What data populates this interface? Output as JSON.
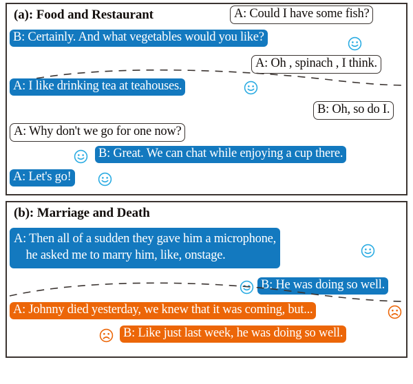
{
  "figure": {
    "colors": {
      "speaker_a_positive": "#1379bf",
      "speaker_b_positive": "#1379bf",
      "negative": "#ec6608",
      "neutral_border": "#3a3330",
      "panel_border": "#3a3330",
      "emoji_happy": "#29ABE2",
      "emoji_sad": "#ec6608",
      "text_on_color": "#ffffff",
      "text_plain": "#120d0b"
    },
    "panels": [
      {
        "id": "a",
        "title": "(a): Food and Restaurant",
        "messages": [
          {
            "id": "a1",
            "text": "A: Could I have some fish?",
            "style": "plain",
            "emoji": "none"
          },
          {
            "id": "a2",
            "text": "B: Certainly. And what vegetables would you like?",
            "style": "blue",
            "emoji": "happy"
          },
          {
            "id": "a3",
            "text": "A: Oh , spinach , I think.",
            "style": "plain",
            "emoji": "none"
          },
          {
            "id": "a4",
            "text": "A: I like drinking tea at teahouses.",
            "style": "blue",
            "emoji": "happy"
          },
          {
            "id": "a5",
            "text": "B: Oh, so do I.",
            "style": "plain",
            "emoji": "none"
          },
          {
            "id": "a6",
            "text": "A: Why don't we go for one now?",
            "style": "plain",
            "emoji": "none"
          },
          {
            "id": "a7",
            "text": "B: Great. We can chat while enjoying a cup there.",
            "style": "blue",
            "emoji": "happy"
          },
          {
            "id": "a8",
            "text": "A: Let's go!",
            "style": "blue",
            "emoji": "happy"
          }
        ],
        "separator_after": "a3"
      },
      {
        "id": "b",
        "title": "(b): Marriage and Death",
        "messages": [
          {
            "id": "b1",
            "line1": "A: Then all of a sudden they gave him a microphone,",
            "line2": "    he asked me to marry him, like, onstage.",
            "style": "blue",
            "emoji": "happy"
          },
          {
            "id": "b2",
            "text": "B: He was doing so well.",
            "style": "blue",
            "emoji": "happy"
          },
          {
            "id": "b3",
            "text": "A: Johnny died yesterday, we knew that it was coming, but...",
            "style": "orange",
            "emoji": "sad"
          },
          {
            "id": "b4",
            "text": "B: Like just last week, he was doing so well.",
            "style": "orange",
            "emoji": "sad"
          }
        ],
        "separator_after": "b2"
      }
    ],
    "icons": {
      "happy": "smiley-face-icon",
      "sad": "frowning-face-icon",
      "separator": "wavy-dashed-divider-icon"
    }
  }
}
